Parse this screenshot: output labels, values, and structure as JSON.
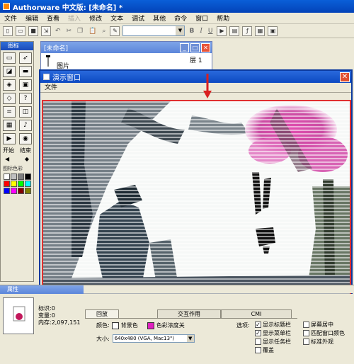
{
  "app": {
    "title": "Authorware 中文版: [未命名] *"
  },
  "menu": [
    "文件",
    "编辑",
    "查看",
    "插入",
    "修改",
    "文本",
    "调试",
    "其他",
    "命令",
    "窗口",
    "帮助"
  ],
  "menu_disabled": [
    "插入"
  ],
  "toolbar": {
    "bold_label": "B",
    "italic_label": "I",
    "underline_label": "U"
  },
  "palette": {
    "title": "图标",
    "start_label": "开始",
    "end_label": "结束",
    "color_caption": "图标色彩",
    "colors": [
      "#ffffff",
      "#c0c0c0",
      "#808080",
      "#000000",
      "#ff0000",
      "#ffff00",
      "#00ff00",
      "#00ffff",
      "#0000ff",
      "#ff00ff",
      "#800000",
      "#808000"
    ]
  },
  "design_window": {
    "title": "[未命名]",
    "layer_label": "层 1",
    "item_label": "图片"
  },
  "presentation_window": {
    "title": "演示窗口",
    "menu_file": "文件"
  },
  "properties": {
    "title": "属性",
    "info_lines": [
      "标识:0",
      "变量:0",
      "内存:2,097,151"
    ],
    "tabs": [
      "回放",
      "交互作用",
      "CMI"
    ],
    "color_label": "颜色:",
    "background_label": "背景色",
    "chroma_label": "色彩浓度关",
    "size_label": "大小:",
    "size_value": "640x480 (VGA, Mac13\")",
    "options_label": "选项:",
    "options": [
      {
        "label": "显示标题栏",
        "checked": true
      },
      {
        "label": "显示菜单栏",
        "checked": true
      },
      {
        "label": "显示任务栏",
        "checked": false
      },
      {
        "label": "覆盖",
        "checked": false
      }
    ],
    "options_right": [
      {
        "label": "屏幕居中",
        "checked": false
      },
      {
        "label": "匹配窗口颜色",
        "checked": false
      },
      {
        "label": "标准外观",
        "checked": false
      }
    ]
  }
}
